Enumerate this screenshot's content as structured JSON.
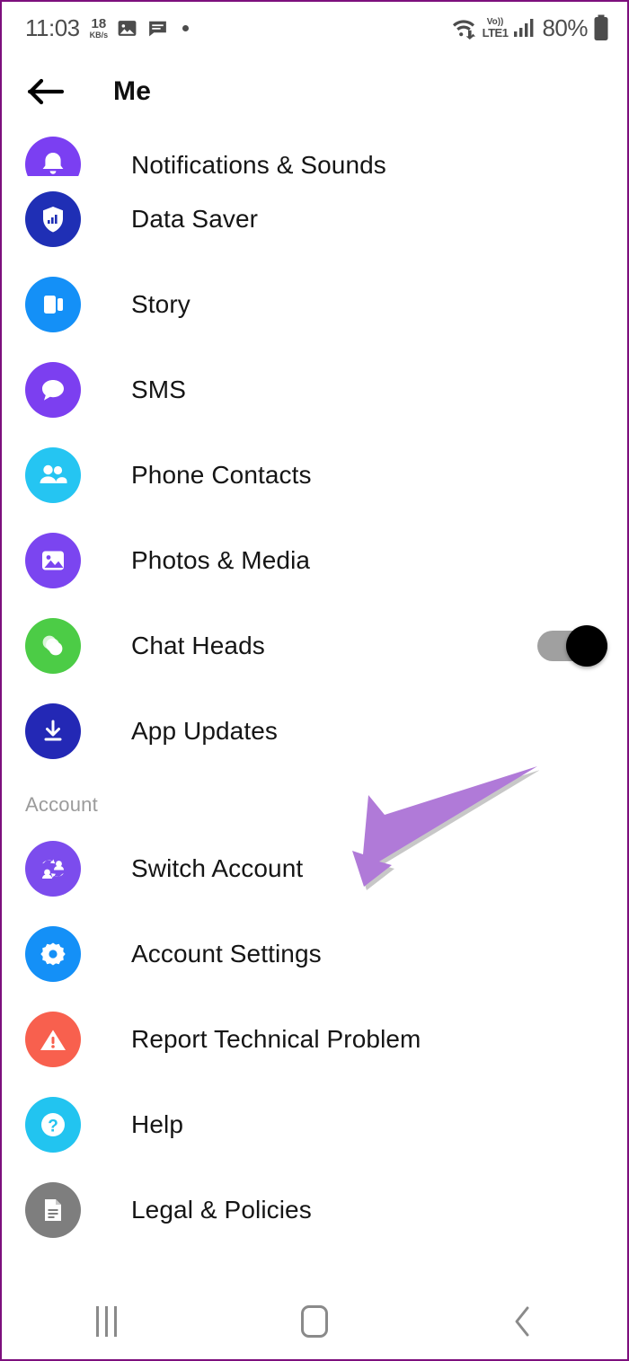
{
  "status_bar": {
    "time": "11:03",
    "network_speed_value": "18",
    "network_speed_unit": "KB/s",
    "icons": [
      "image-icon",
      "message-icon",
      "dot-indicator-icon"
    ],
    "wifi_icon": "wifi-icon",
    "volte_line1": "Vo))",
    "volte_line2": "LTE1",
    "signal_icon": "cellular-signal-icon",
    "battery_percent": "80%",
    "battery_icon": "battery-icon"
  },
  "app_bar": {
    "back_icon": "back-arrow-icon",
    "title": "Me"
  },
  "list": {
    "items": [
      {
        "label": "Notifications & Sounds",
        "icon": "bell-icon",
        "color": "#7b3ff2",
        "clipped": true,
        "toggle": null
      },
      {
        "label": "Data Saver",
        "icon": "shield-bars-icon",
        "color": "#1f2fb5",
        "clipped": false,
        "toggle": null
      },
      {
        "label": "Story",
        "icon": "story-cards-icon",
        "color": "#1490f7",
        "clipped": false,
        "toggle": null
      },
      {
        "label": "SMS",
        "icon": "chat-bubble-icon",
        "color": "#7c3ff0",
        "clipped": false,
        "toggle": null
      },
      {
        "label": "Phone Contacts",
        "icon": "people-icon",
        "color": "#25c5f2",
        "clipped": false,
        "toggle": null
      },
      {
        "label": "Photos & Media",
        "icon": "photo-icon",
        "color": "#7b45f0",
        "clipped": false,
        "toggle": null
      },
      {
        "label": "Chat Heads",
        "icon": "chat-heads-icon",
        "color": "#4ccc46",
        "clipped": false,
        "toggle": "on"
      },
      {
        "label": "App Updates",
        "icon": "download-icon",
        "color": "#2328b5",
        "clipped": false,
        "toggle": null
      }
    ]
  },
  "account_section": {
    "header": "Account",
    "items": [
      {
        "label": "Switch Account",
        "icon": "switch-account-icon",
        "color": "#7c4ced"
      },
      {
        "label": "Account Settings",
        "icon": "gear-icon",
        "color": "#1490f7"
      },
      {
        "label": "Report Technical Problem",
        "icon": "warning-triangle-icon",
        "color": "#f8604e"
      },
      {
        "label": "Help",
        "icon": "question-mark-icon",
        "color": "#22c4f0"
      },
      {
        "label": "Legal & Policies",
        "icon": "document-icon",
        "color": "#7e7e7e"
      }
    ]
  },
  "annotation": {
    "shape": "arrow-pointing-to-switch-account",
    "color": "#b07ad8"
  },
  "nav_bar": {
    "recents_icon": "recents-icon",
    "home_icon": "home-icon",
    "back_icon": "back-chevron-icon"
  },
  "theme": {
    "border": "#7d0f7d",
    "background": "#ffffff",
    "text": "#151515",
    "section_header_text": "#9b9b9b",
    "toggle_track": "#a0a0a0",
    "toggle_knob": "#000000"
  }
}
